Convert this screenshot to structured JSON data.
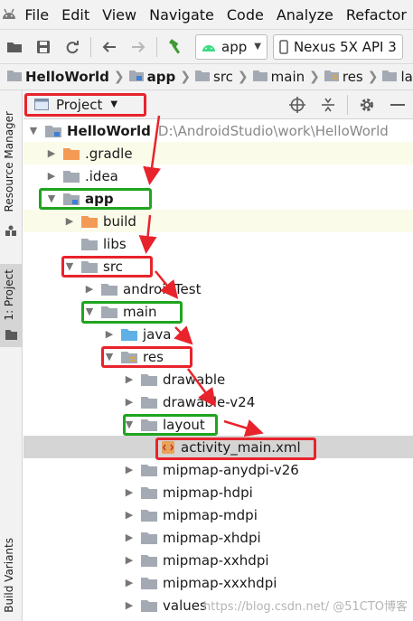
{
  "menubar": {
    "items": [
      "File",
      "Edit",
      "View",
      "Navigate",
      "Code",
      "Analyze",
      "Refactor"
    ]
  },
  "toolbar": {
    "module_combo": "app",
    "device_combo": "Nexus 5X API 3"
  },
  "breadcrumb": [
    "HelloWorld",
    "app",
    "src",
    "main",
    "res",
    "layou"
  ],
  "side_tabs": {
    "resource_manager": "Resource Manager",
    "project": "1: Project",
    "build_variants": "Build Variants"
  },
  "project_panel": {
    "view_selector": "Project"
  },
  "tree": {
    "root_name": "HelloWorld",
    "root_path": "D:\\AndroidStudio\\work\\HelloWorld",
    "items": [
      "HelloWorld",
      ".gradle",
      ".idea",
      "app",
      "build",
      "libs",
      "src",
      "androidTest",
      "main",
      "java",
      "res",
      "drawable",
      "drawable-v24",
      "layout",
      "activity_main.xml",
      "mipmap-anydpi-v26",
      "mipmap-hdpi",
      "mipmap-mdpi",
      "mipmap-xhdpi",
      "mipmap-xxhdpi",
      "mipmap-xxxhdpi",
      "values"
    ]
  },
  "watermark": "https://blog.csdn.net/ @51CTO博客",
  "colors": {
    "annotation_red": "#e8232b",
    "annotation_green": "#1fa51f",
    "folder_gray": "#a3aab3",
    "folder_orange": "#f39a55",
    "folder_blue": "#5fb0e6",
    "selected_row": "#d5d5d5"
  }
}
